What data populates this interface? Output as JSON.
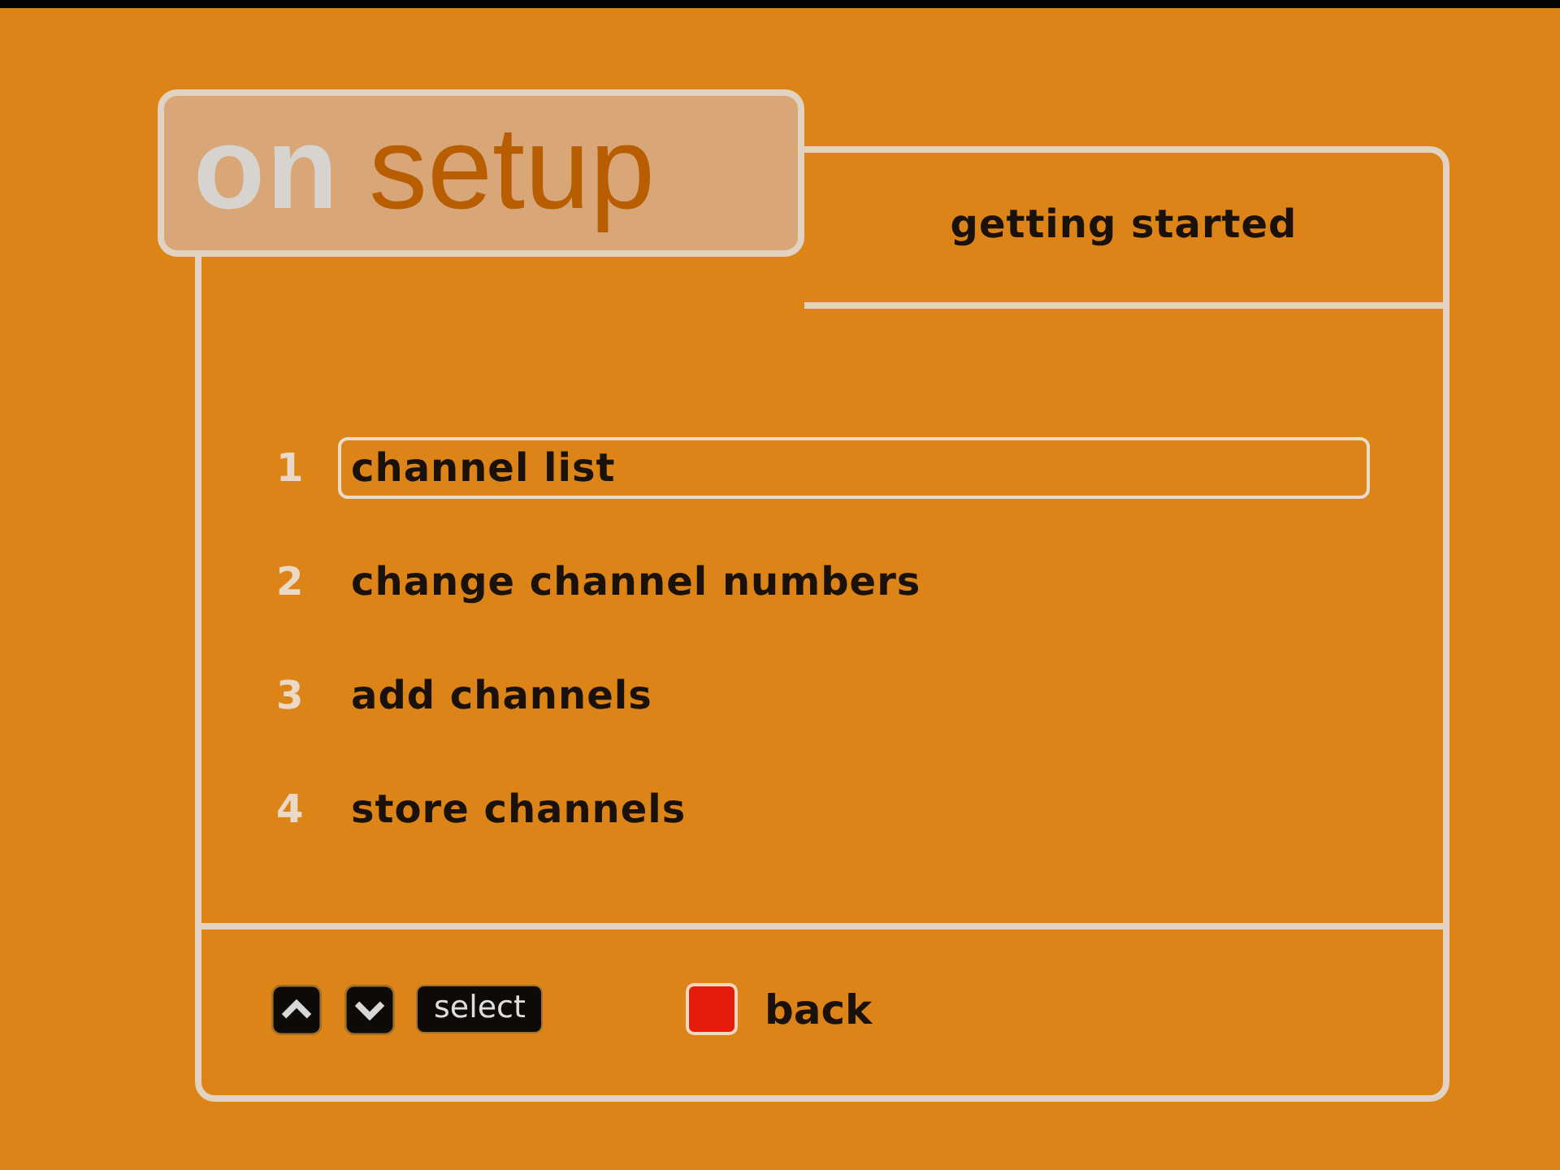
{
  "logo": {
    "brand": "on",
    "product": "setup"
  },
  "heading": "getting started",
  "menu": [
    {
      "number": "1",
      "label": "channel list",
      "selected": true
    },
    {
      "number": "2",
      "label": "change channel numbers",
      "selected": false
    },
    {
      "number": "3",
      "label": "add channels",
      "selected": false
    },
    {
      "number": "4",
      "label": "store channels",
      "selected": false
    }
  ],
  "footer": {
    "nav_keys": [
      {
        "kind": "up"
      },
      {
        "kind": "down"
      }
    ],
    "select_label": "select",
    "back": {
      "color": "#e51c0c",
      "label": "back"
    }
  }
}
